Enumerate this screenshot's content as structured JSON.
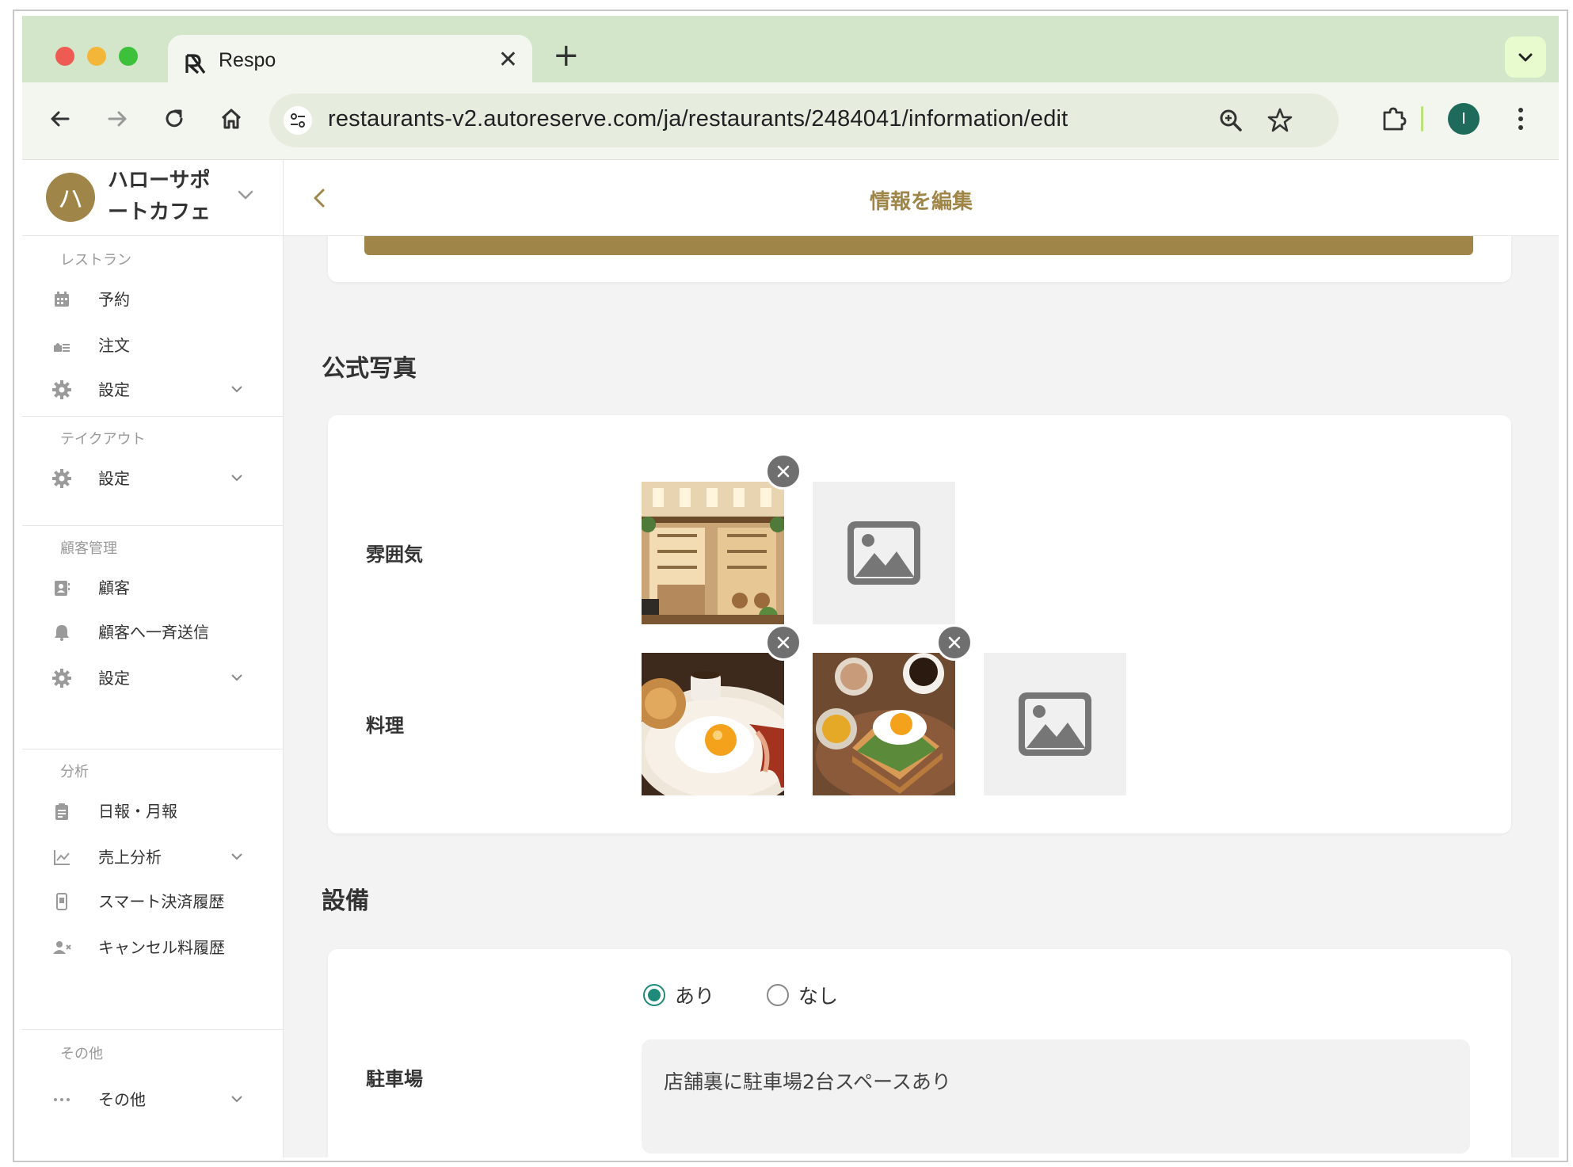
{
  "browser": {
    "tab_title": "Respo",
    "url": "restaurants-v2.autoreserve.com/ja/restaurants/2484041/information/edit",
    "profile_initial": "I"
  },
  "brand": {
    "avatar_char": "ハ",
    "name": "ハローサポートカフェ"
  },
  "sidebar": {
    "restaurant": {
      "heading": "レストラン",
      "items": [
        {
          "label": "予約",
          "icon": "calendar-icon"
        },
        {
          "label": "注文",
          "icon": "order-icon"
        },
        {
          "label": "設定",
          "icon": "gear-icon"
        }
      ]
    },
    "takeout": {
      "heading": "テイクアウト",
      "items": [
        {
          "label": "設定",
          "icon": "gear-icon"
        }
      ]
    },
    "customers": {
      "heading": "顧客管理",
      "items": [
        {
          "label": "顧客",
          "icon": "contact-card-icon"
        },
        {
          "label": "顧客へ一斉送信",
          "icon": "bell-icon"
        },
        {
          "label": "設定",
          "icon": "gear-icon"
        }
      ]
    },
    "analytics": {
      "heading": "分析",
      "items": [
        {
          "label": "日報・月報",
          "icon": "clipboard-icon"
        },
        {
          "label": "売上分析",
          "icon": "line-chart-icon"
        },
        {
          "label": "スマート決済履歴",
          "icon": "phone-payment-icon"
        },
        {
          "label": "キャンセル料履歴",
          "icon": "user-cancel-icon"
        }
      ]
    },
    "other": {
      "heading": "その他",
      "items": [
        {
          "label": "その他",
          "icon": "more-dots-icon"
        }
      ]
    }
  },
  "header": {
    "title": "情報を編集"
  },
  "photos_section": {
    "title": "公式写真",
    "rows": [
      {
        "label": "雰囲気"
      },
      {
        "label": "料理"
      }
    ]
  },
  "facilities_section": {
    "title": "設備",
    "parking": {
      "label": "駐車場",
      "options": [
        "あり",
        "なし"
      ],
      "selected": "あり",
      "note": "店舗裏に駐車場2台スペースあり"
    }
  },
  "colors": {
    "accent": "#a08548",
    "radio_selected": "#1f8a7a",
    "chrome_tabbar": "#d3e6ca"
  }
}
